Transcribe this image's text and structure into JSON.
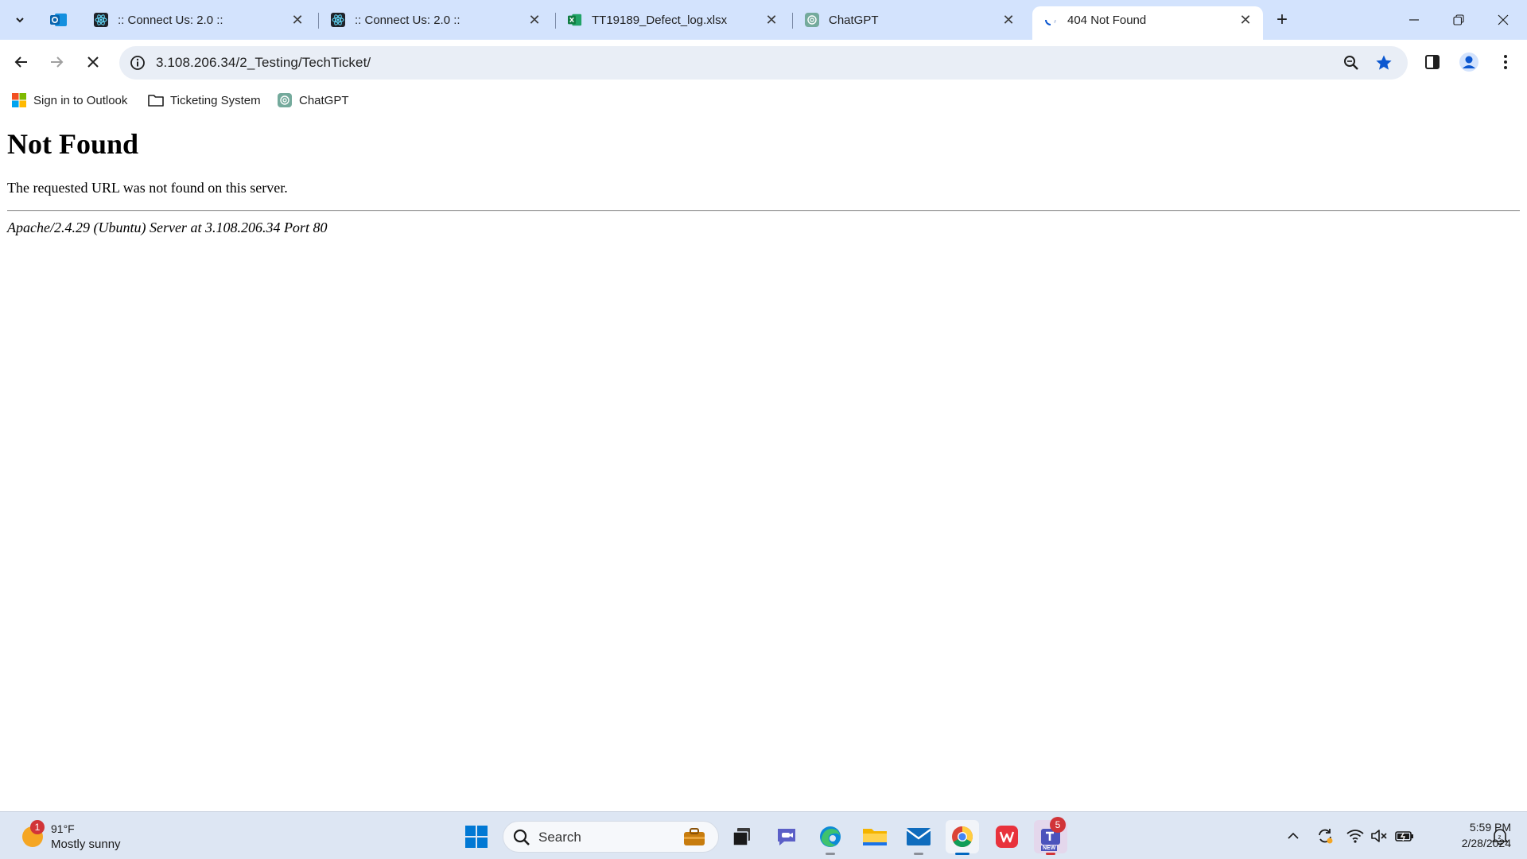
{
  "browser": {
    "tabs": [
      {
        "title": ":: Connect Us: 2.0 ::",
        "icon": "react-atom-icon",
        "active": false
      },
      {
        "title": ":: Connect Us: 2.0 ::",
        "icon": "react-atom-icon",
        "active": false
      },
      {
        "title": "TT19189_Defect_log.xlsx",
        "icon": "excel-icon",
        "active": false
      },
      {
        "title": "ChatGPT",
        "icon": "chatgpt-icon",
        "active": false
      },
      {
        "title": "404 Not Found",
        "icon": "loading-spinner-icon",
        "active": true
      }
    ],
    "pinned_tab_icon": "outlook-icon",
    "address": {
      "url": "3.108.206.34/2_Testing/TechTicket/"
    },
    "bookmarks": [
      {
        "label": "Sign in to Outlook",
        "icon": "microsoft-logo-icon"
      },
      {
        "label": "Ticketing System",
        "icon": "folder-icon"
      },
      {
        "label": "ChatGPT",
        "icon": "chatgpt-icon"
      }
    ]
  },
  "page": {
    "heading": "Not Found",
    "message": "The requested URL was not found on this server.",
    "server_signature": "Apache/2.4.29 (Ubuntu) Server at 3.108.206.34 Port 80"
  },
  "taskbar": {
    "weather": {
      "badge": "1",
      "temp": "91°F",
      "condition": "Mostly sunny"
    },
    "search_label": "Search",
    "teams_badge": "5",
    "teams_tag": "NEW",
    "clock": {
      "time": "5:59 PM",
      "date": "2/28/2024"
    }
  },
  "colors": {
    "tabstrip": "#d3e3fd",
    "omnibox": "#e9eef6",
    "accent": "#0b57d0",
    "taskbar": "#dde6f3"
  }
}
